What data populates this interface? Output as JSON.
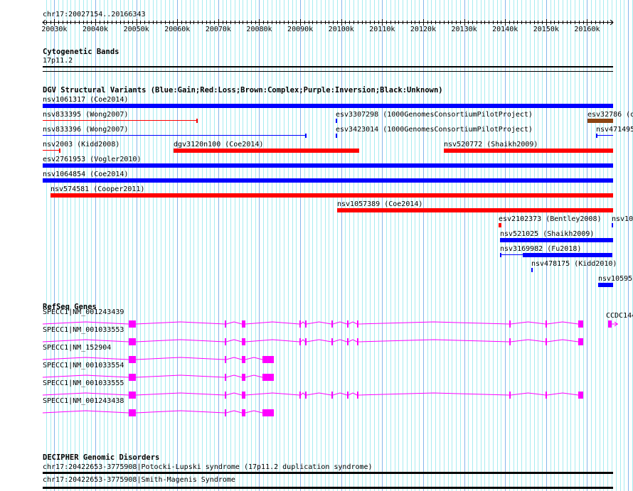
{
  "view": {
    "location": "chr17:20027154..20166343",
    "start": 20027154,
    "end": 20166343
  },
  "ruler": {
    "tick_labels": [
      "20030k",
      "20040k",
      "20050k",
      "20060k",
      "20070k",
      "20080k",
      "20090k",
      "20100k",
      "20110k",
      "20120k",
      "20130k",
      "20140k",
      "20150k",
      "20160k"
    ]
  },
  "colors": {
    "gain": "#0000ff",
    "loss": "#ff0000",
    "complex": "#8b4513",
    "gene": "#ff00ff",
    "grid_minor": "#a8ecf0",
    "grid_major": "#86b6ea"
  },
  "cytobands": {
    "title": "Cytogenetic Bands",
    "band": "17p11.2"
  },
  "dgv": {
    "title": "DGV Structural Variants (Blue:Gain;Red:Loss;Brown:Complex;Purple:Inversion;Black:Unknown)",
    "features": [
      {
        "label": "nsv1061317 (Coe2014)",
        "start": 20027154,
        "end": 20166343,
        "color": "#0000ff",
        "style": "bar",
        "row": 0
      },
      {
        "label": "nsv833395 (Wong2007)",
        "start": 20027154,
        "end": 20064912,
        "color": "#ff0000",
        "style": "line",
        "row": 1
      },
      {
        "label": "esv3307298 (1000GenomesConsortiumPilotProject)",
        "start": 20098668,
        "end": 20098900,
        "color": "#0000ff",
        "style": "bar",
        "row": 1
      },
      {
        "label": "esv32786 (d",
        "start": 20160090,
        "end": 20166343,
        "color": "#8b4513",
        "style": "bar",
        "row": 1
      },
      {
        "label": "nsv833396 (Wong2007)",
        "start": 20027154,
        "end": 20091534,
        "color": "#0000ff",
        "style": "line",
        "row": 2
      },
      {
        "label": "esv3423014 (1000GenomesConsortiumPilotProject)",
        "start": 20098668,
        "end": 20098900,
        "color": "#0000ff",
        "style": "bar",
        "row": 2
      },
      {
        "label": "nsv471495",
        "start": 20162178,
        "end": 20166343,
        "color": "#0000ff",
        "style": "line-left",
        "row": 2
      },
      {
        "label": "nsv2003 (Kidd2008)",
        "start": 20027154,
        "end": 20031504,
        "color": "#ff0000",
        "style": "line",
        "row": 3
      },
      {
        "label": "dgv3120n100 (Coe2014)",
        "start": 20059170,
        "end": 20104410,
        "color": "#ff0000",
        "style": "bar",
        "row": 3
      },
      {
        "label": "nsv520772 (Shaikh2009)",
        "start": 20125116,
        "end": 20166343,
        "color": "#ff0000",
        "style": "bar",
        "row": 3
      },
      {
        "label": "esv2761953 (Vogler2010)",
        "start": 20027154,
        "end": 20166343,
        "color": "#0000ff",
        "style": "bar",
        "row": 4
      },
      {
        "label": "nsv1064854 (Coe2014)",
        "start": 20027154,
        "end": 20166343,
        "color": "#0000ff",
        "style": "bar",
        "row": 5
      },
      {
        "label": "nsv574581 (Cooper2011)",
        "start": 20029068,
        "end": 20166343,
        "color": "#ff0000",
        "style": "bar",
        "row": 6
      },
      {
        "label": "nsv1057389 (Coe2014)",
        "start": 20099016,
        "end": 20166343,
        "color": "#ff0000",
        "style": "bar",
        "row": 7
      },
      {
        "label": "esv2102373 (Bentley2008)",
        "start": 20138340,
        "end": 20139036,
        "color": "#ff0000",
        "style": "bar",
        "row": 8
      },
      {
        "label": "nsv10",
        "start": 20166000,
        "end": 20166343,
        "color": "#0000ff",
        "style": "bar",
        "row": 8
      },
      {
        "label": "nsv521025 (Shaikh2009)",
        "start": 20138688,
        "end": 20166343,
        "color": "#0000ff",
        "style": "bar",
        "row": 9
      },
      {
        "label": "nsv3169982 (Fu2018)",
        "start": 20138688,
        "end": 20166200,
        "thick_start": 20144256,
        "color": "#0000ff",
        "style": "line-thick",
        "row": 10
      },
      {
        "label": "nsv478175 (Kidd2010)",
        "start": 20146344,
        "end": 20146600,
        "color": "#0000ff",
        "style": "bar",
        "row": 11
      },
      {
        "label": "nsv10595",
        "start": 20162700,
        "end": 20166343,
        "color": "#0000ff",
        "style": "bar",
        "row": 12
      }
    ]
  },
  "refseq": {
    "title": "RefSeq Genes",
    "genes": [
      {
        "label": "SPECC1|NM_001243439",
        "start": 20027154,
        "end": 20159400,
        "exons": [
          [
            20048208,
            20049948
          ],
          [
            20071524,
            20071872
          ],
          [
            20075700,
            20076570
          ],
          [
            20089794,
            20090142
          ],
          [
            20091186,
            20091534
          ],
          [
            20097624,
            20097972
          ],
          [
            20101452,
            20101800
          ],
          [
            20103888,
            20104236
          ],
          [
            20140950,
            20141298
          ],
          [
            20149824,
            20150172
          ],
          [
            20157828,
            20159046
          ]
        ]
      },
      {
        "label": "SPECC1|NM_001033553",
        "start": 20027154,
        "end": 20159400,
        "exons": [
          [
            20048208,
            20049948
          ],
          [
            20071524,
            20071872
          ],
          [
            20075700,
            20076570
          ],
          [
            20089794,
            20090142
          ],
          [
            20091186,
            20091534
          ],
          [
            20097624,
            20097972
          ],
          [
            20101452,
            20101800
          ],
          [
            20103888,
            20104236
          ],
          [
            20140950,
            20141298
          ],
          [
            20149824,
            20150172
          ],
          [
            20157828,
            20159046
          ]
        ]
      },
      {
        "label": "SPECC1|NM_152904",
        "start": 20027154,
        "end": 20083530,
        "exons": [
          [
            20048208,
            20049948
          ],
          [
            20071524,
            20071872
          ],
          [
            20075700,
            20076570
          ],
          [
            20080746,
            20083530
          ]
        ]
      },
      {
        "label": "SPECC1|NM_001033554",
        "start": 20027154,
        "end": 20083530,
        "exons": [
          [
            20048208,
            20049948
          ],
          [
            20071524,
            20071872
          ],
          [
            20075700,
            20076570
          ],
          [
            20080746,
            20083530
          ]
        ]
      },
      {
        "label": "SPECC1|NM_001033555",
        "start": 20027154,
        "end": 20159400,
        "exons": [
          [
            20048208,
            20049948
          ],
          [
            20071524,
            20071872
          ],
          [
            20075700,
            20076570
          ],
          [
            20089794,
            20090142
          ],
          [
            20091186,
            20091534
          ],
          [
            20097624,
            20097972
          ],
          [
            20101452,
            20101800
          ],
          [
            20103888,
            20104236
          ],
          [
            20140950,
            20141298
          ],
          [
            20149824,
            20150172
          ],
          [
            20157828,
            20159046
          ]
        ]
      },
      {
        "label": "SPECC1|NM_001243438",
        "start": 20027154,
        "end": 20083530,
        "exons": [
          [
            20048208,
            20049948
          ],
          [
            20071524,
            20071872
          ],
          [
            20075700,
            20076570
          ],
          [
            20080746,
            20083530
          ]
        ]
      }
    ],
    "other_gene": {
      "label": "CCDC144",
      "start": 20165136,
      "end": 20166343
    }
  },
  "decipher": {
    "title": "DECIPHER Genomic Disorders",
    "items": [
      "chr17:20422653-3775908|Potocki-Lupski syndrome (17p11.2 duplication syndrome)",
      "chr17:20422653-3775908|Smith-Magenis Syndrome"
    ]
  }
}
